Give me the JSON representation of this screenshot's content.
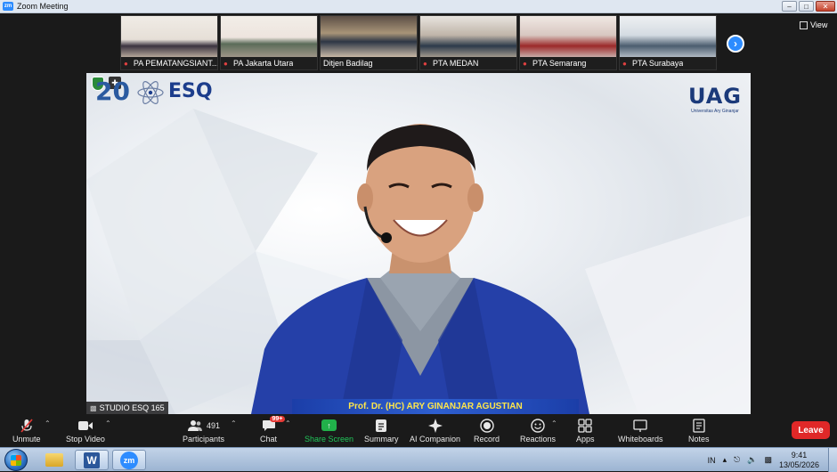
{
  "window": {
    "title": "Zoom Meeting",
    "app_icon": "zm",
    "controls": [
      "minimize-icon",
      "maximize-icon",
      "close-icon"
    ]
  },
  "thumbnails": [
    {
      "name": "PA PEMATANGSIANT..."
    },
    {
      "name": "PA Jakarta Utara"
    },
    {
      "name": "Ditjen Badilag"
    },
    {
      "name": "PTA MEDAN"
    },
    {
      "name": "PTA Semarang"
    },
    {
      "name": "PTA Surabaya"
    }
  ],
  "view_button": {
    "label": "View"
  },
  "speaker": {
    "name_caption": "Prof. Dr. (HC) ARY GINANJAR AGUSTIAN",
    "studio_label": "STUDIO ESQ 165",
    "logo_left": "20",
    "logo_left_brand": "ESQ",
    "logo_right": "UAG",
    "logo_right_sub": "Universitas Ary Ginanjar"
  },
  "toolbar": {
    "unmute": "Unmute",
    "stop_video": "Stop Video",
    "participants": "Participants",
    "participant_count": "491",
    "chat": "Chat",
    "chat_badge": "99+",
    "share_screen": "Share Screen",
    "summary": "Summary",
    "ai_companion": "AI Companion",
    "record": "Record",
    "reactions": "Reactions",
    "apps": "Apps",
    "whiteboards": "Whiteboards",
    "notes": "Notes",
    "leave": "Leave"
  },
  "taskbar": {
    "language": "IN",
    "time": "9:41",
    "date": "13/05/2026"
  },
  "colors": {
    "zoom_blue": "#2d8cff",
    "leave_red": "#e02828",
    "share_green": "#21b14a",
    "name_bar_blue": "#1b3ea8",
    "name_text_yellow": "#ffe64a"
  }
}
